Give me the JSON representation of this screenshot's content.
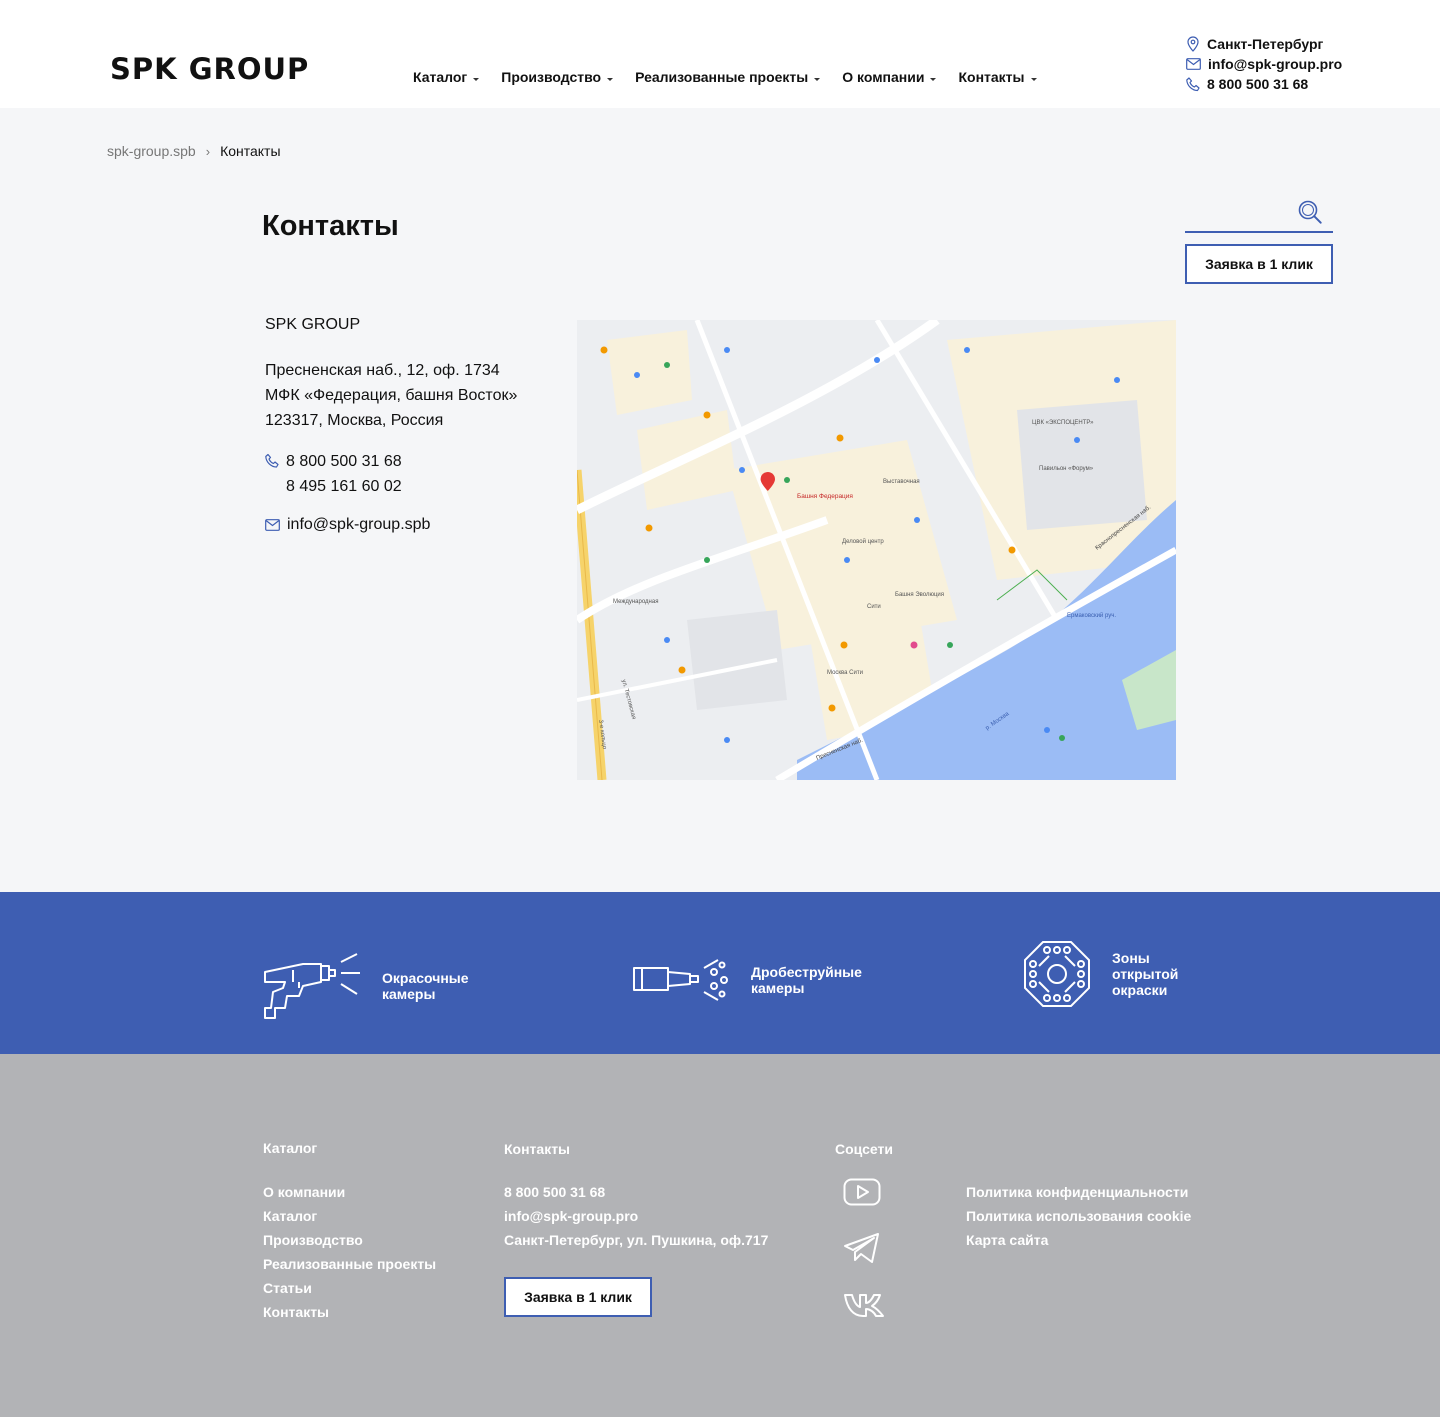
{
  "header": {
    "logo": "SPK GROUP",
    "nav": [
      "Каталог",
      "Производство",
      "Реализованные проекты",
      "О компании",
      "Контакты"
    ],
    "city": "Санкт-Петербург",
    "email": "info@spk-group.pro",
    "phone": "8 800 500 31 68"
  },
  "breadcrumb": {
    "home": "spk-group.spb",
    "current": "Контакты"
  },
  "page": {
    "title": "Контакты",
    "request_button": "Заявка в 1 клик",
    "search_placeholder": ""
  },
  "contact": {
    "company": "SPK GROUP",
    "address": [
      "Пресненская наб., 12, оф. 1734",
      "МФК «Федерация, башня Восток»",
      "123317, Москва, Россия"
    ],
    "phones": [
      "8 800 500 31 68",
      "8 495 161 60 02"
    ],
    "email": "info@spk-group.spb"
  },
  "map": {
    "labels": [
      "Башня Федерация",
      "Москва Сити",
      "Деловой центр",
      "Выставочная",
      "Международная",
      "Башня Эволюция",
      "р. Москва",
      "Пресненская наб.",
      "Краснопресненская наб.",
      "Ермаковский руч.",
      "ЦВК «ЭКСПОЦЕНТР»",
      "Павильон «Форум»",
      "Сити",
      "ул. Тестовская",
      "3-е кольцо"
    ],
    "marker_color": "#e53935",
    "water_color": "#9bbcf5",
    "road_color": "#f6d36a"
  },
  "band": {
    "items": [
      {
        "label_1": "Окрасочные",
        "label_2": "камеры"
      },
      {
        "label_1": "Дробеструйные",
        "label_2": "камеры"
      },
      {
        "label_1": "Зоны",
        "label_2": "открытой",
        "label_3": "окраски"
      }
    ],
    "color": "#3e5eb2"
  },
  "footer": {
    "catalog_head": "Каталог",
    "catalog_links": [
      "О компании",
      "Каталог",
      "Производство",
      "Реализованные проекты",
      "Статьи",
      "Контакты"
    ],
    "contacts_head": "Контакты",
    "phone": "8 800 500 31 68",
    "email": "info@spk-group.pro",
    "address": "Санкт-Петербург, ул. Пушкина, оф.717",
    "request_button": "Заявка в 1 клик",
    "social_head": "Соцсети",
    "social_icons": [
      "youtube-icon",
      "telegram-icon",
      "vk-icon"
    ],
    "legal_links": [
      "Политика конфиденциальности",
      "Политика использования cookie",
      "Карта сайта"
    ]
  }
}
